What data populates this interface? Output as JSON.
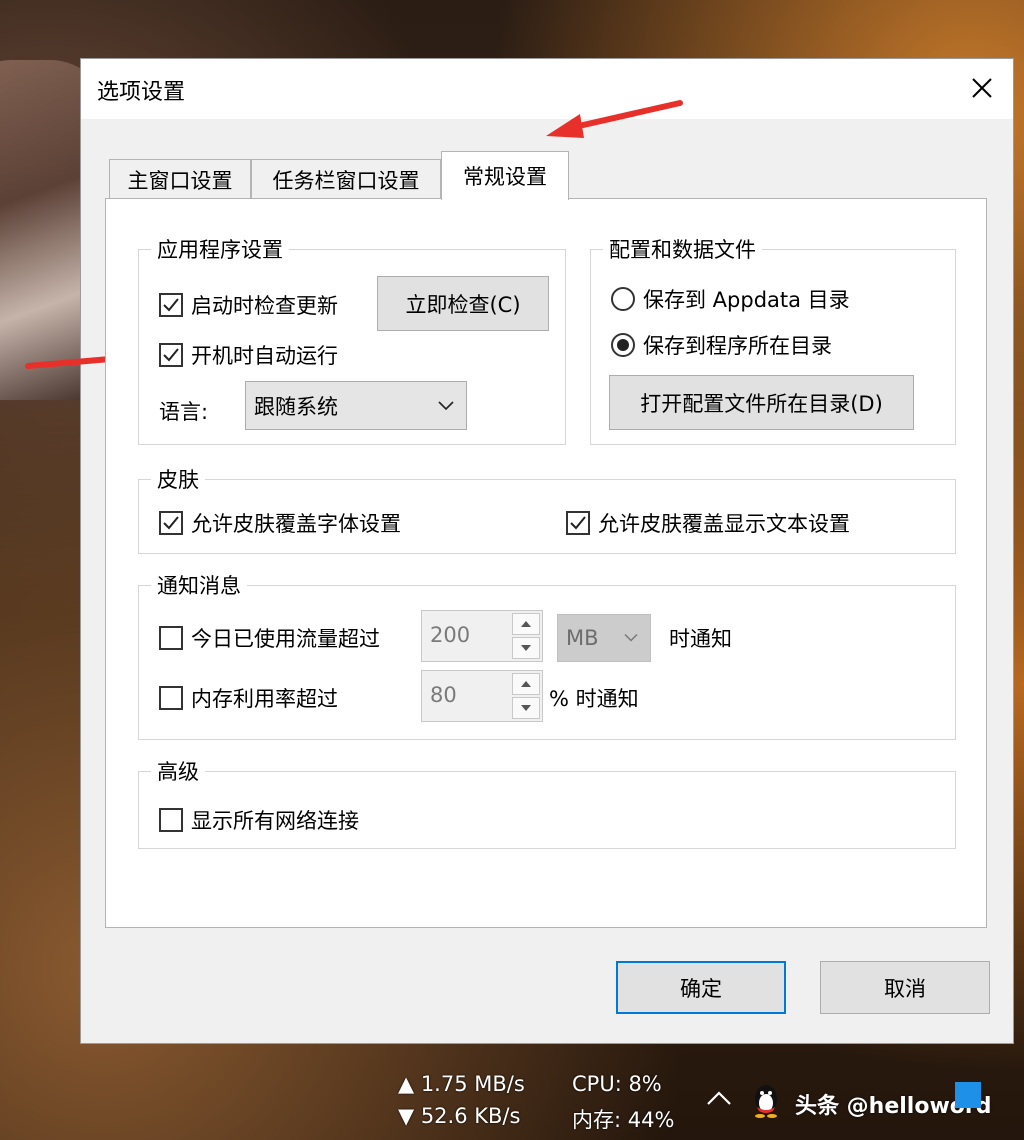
{
  "dialog": {
    "title": "选项设置",
    "tabs": [
      {
        "label": "主窗口设置"
      },
      {
        "label": "任务栏窗口设置"
      },
      {
        "label": "常规设置"
      }
    ],
    "app_group": {
      "title": "应用程序设置",
      "check_update_label": "启动时检查更新",
      "check_now_label": "立即检查(C)",
      "autorun_label": "开机时自动运行",
      "language_label": "语言:",
      "language_value": "跟随系统"
    },
    "config_group": {
      "title": "配置和数据文件",
      "option_appdata": "保存到 Appdata 目录",
      "option_program_dir": "保存到程序所在目录",
      "open_dir_label": "打开配置文件所在目录(D)"
    },
    "skin_group": {
      "title": "皮肤",
      "allow_font_label": "允许皮肤覆盖字体设置",
      "allow_text_label": "允许皮肤覆盖显示文本设置"
    },
    "notify_group": {
      "title": "通知消息",
      "traffic_label": "今日已使用流量超过",
      "traffic_value": "200",
      "traffic_unit": "MB",
      "traffic_suffix": "时通知",
      "memory_label": "内存利用率超过",
      "memory_value": "80",
      "memory_suffix": "% 时通知"
    },
    "advanced_group": {
      "title": "高级",
      "show_all_label": "显示所有网络连接"
    },
    "ok_label": "确定",
    "cancel_label": "取消"
  },
  "taskbar": {
    "upload": "▲ 1.75 MB/s",
    "download": "▼ 52.6 KB/s",
    "cpu": "CPU: 8%",
    "memory": "内存: 44%",
    "watermark": "头条 @helloword"
  },
  "colors": {
    "accent": "#0078d7",
    "arrow": "#e8302a"
  }
}
